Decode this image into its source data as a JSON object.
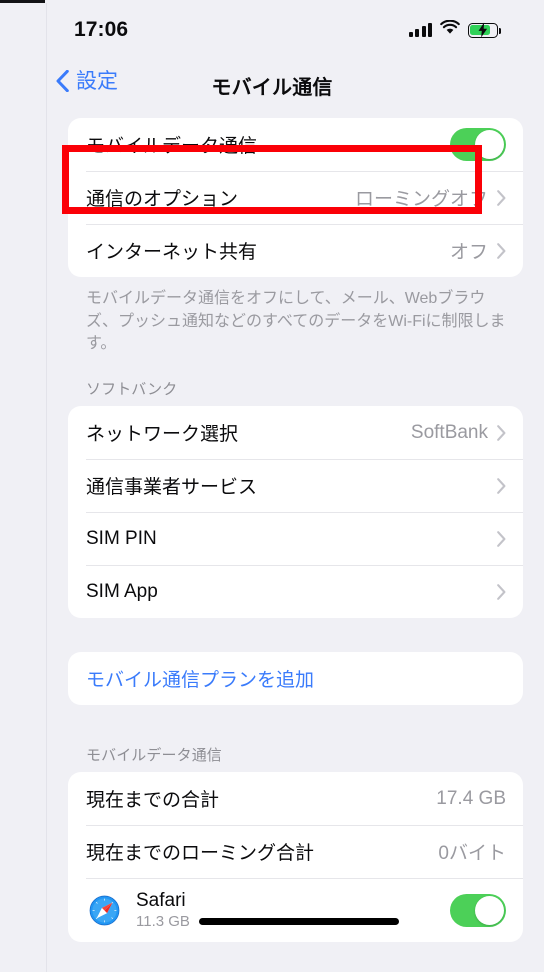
{
  "status_bar": {
    "time": "17:06",
    "signal_icon": "cellular-signal-icon",
    "wifi_icon": "wifi-icon",
    "battery_icon": "battery-charging-icon"
  },
  "nav": {
    "back_label": "設定",
    "back_icon": "chevron-left-icon",
    "title": "モバイル通信"
  },
  "groups": {
    "cellular": {
      "rows": [
        {
          "label": "モバイルデータ通信",
          "value": "",
          "control": "toggle",
          "toggle_on": true
        },
        {
          "label": "通信のオプション",
          "value": "ローミングオフ",
          "control": "chevron"
        },
        {
          "label": "インターネット共有",
          "value": "オフ",
          "control": "chevron"
        }
      ],
      "footer": "モバイルデータ通信をオフにして、メール、Webブラウズ、プッシュ通知などのすべてのデータをWi-Fiに制限します。"
    },
    "carrier": {
      "header": "ソフトバンク",
      "rows": [
        {
          "label": "ネットワーク選択",
          "value": "SoftBank",
          "control": "chevron"
        },
        {
          "label": "通信事業者サービス",
          "value": "",
          "control": "chevron"
        },
        {
          "label": "SIM PIN",
          "value": "",
          "control": "chevron"
        },
        {
          "label": "SIM App",
          "value": "",
          "control": "chevron"
        }
      ]
    },
    "add_plan": {
      "label": "モバイル通信プランを追加"
    },
    "data_usage": {
      "header": "モバイルデータ通信",
      "rows": [
        {
          "label": "現在までの合計",
          "value": "17.4 GB"
        },
        {
          "label": "現在までのローミング合計",
          "value": "0バイト"
        }
      ],
      "apps": [
        {
          "icon": "safari-icon",
          "name": "Safari",
          "usage": "11.3 GB",
          "toggle_on": true
        }
      ]
    }
  },
  "annotation": {
    "highlight_color": "#fb0007",
    "target": "モバイルデータ通信"
  },
  "colors": {
    "accent_blue": "#3a7bfb",
    "toggle_green": "#4cd058",
    "background": "#f0f0f5",
    "card": "#ffffff"
  }
}
